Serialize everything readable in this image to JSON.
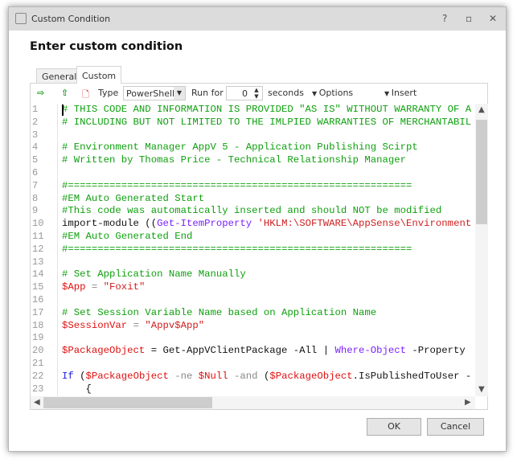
{
  "window": {
    "title": "Custom Condition",
    "buttons": {
      "help": "?",
      "restore": "▫",
      "close": "✕"
    }
  },
  "heading": "Enter custom condition",
  "tabs": [
    {
      "label": "General",
      "active": false
    },
    {
      "label": "Custom",
      "active": true
    }
  ],
  "toolbar": {
    "type_label": "Type",
    "type_value": "PowerShell",
    "run_for_label": "Run for",
    "run_for_value": "0",
    "seconds_label": "seconds",
    "options_label": "Options",
    "insert_label": "Insert"
  },
  "colors": {
    "comment": "#0fa00f",
    "variable": "#e01010",
    "string": "#d02020",
    "cmdlet": "#7a20ff",
    "keyword": "#2020e0"
  },
  "code_lines": [
    [
      [
        "# THIS CODE AND INFORMATION IS PROVIDED \"AS IS\" WITHOUT WARRANTY OF A",
        "c"
      ]
    ],
    [
      [
        "# INCLUDING BUT NOT LIMITED TO THE IMLPIED WARRANTIES OF MERCHANTABIL",
        "c"
      ]
    ],
    [],
    [
      [
        "# Environment Manager AppV 5 - Application Publishing Scirpt",
        "c"
      ]
    ],
    [
      [
        "# Written by Thomas Price - Technical Relationship Manager",
        "c"
      ]
    ],
    [],
    [
      [
        "#==========================================================",
        "c"
      ]
    ],
    [
      [
        "#EM Auto Generated Start",
        "c"
      ]
    ],
    [
      [
        "#This code was automatically inserted and should NOT be modified",
        "c"
      ]
    ],
    [
      [
        "import-module ((",
        ""
      ],
      [
        "Get-ItemProperty",
        "f"
      ],
      [
        " ",
        ""
      ],
      [
        "'HKLM:\\SOFTWARE\\AppSense\\Environment",
        "s"
      ]
    ],
    [
      [
        "#EM Auto Generated End",
        "c"
      ]
    ],
    [
      [
        "#==========================================================",
        "c"
      ]
    ],
    [],
    [
      [
        "# Set Application Name Manually",
        "c"
      ]
    ],
    [
      [
        "$App",
        "v"
      ],
      [
        " = ",
        "o"
      ],
      [
        "\"Foxit\"",
        "s"
      ]
    ],
    [],
    [
      [
        "# Set Session Variable Name based on Application Name",
        "c"
      ]
    ],
    [
      [
        "$SessionVar",
        "v"
      ],
      [
        " = ",
        "o"
      ],
      [
        "\"Appv$App\"",
        "s"
      ]
    ],
    [],
    [
      [
        "$PackageObject",
        "v"
      ],
      [
        " = Get-AppVClientPackage -All | ",
        ""
      ],
      [
        "Where-Object",
        "f"
      ],
      [
        " -Property",
        ""
      ]
    ],
    [],
    [
      [
        "If",
        "k"
      ],
      [
        " (",
        ""
      ],
      [
        "$PackageObject",
        "v"
      ],
      [
        " -ne ",
        "o"
      ],
      [
        "$Null",
        "v"
      ],
      [
        " -and ",
        "o"
      ],
      [
        "(",
        ""
      ],
      [
        "$PackageObject",
        "v"
      ],
      [
        ".IsPublishedToUser -",
        ""
      ]
    ],
    [
      [
        "    {",
        ""
      ]
    ]
  ],
  "footer": {
    "ok": "OK",
    "cancel": "Cancel"
  }
}
